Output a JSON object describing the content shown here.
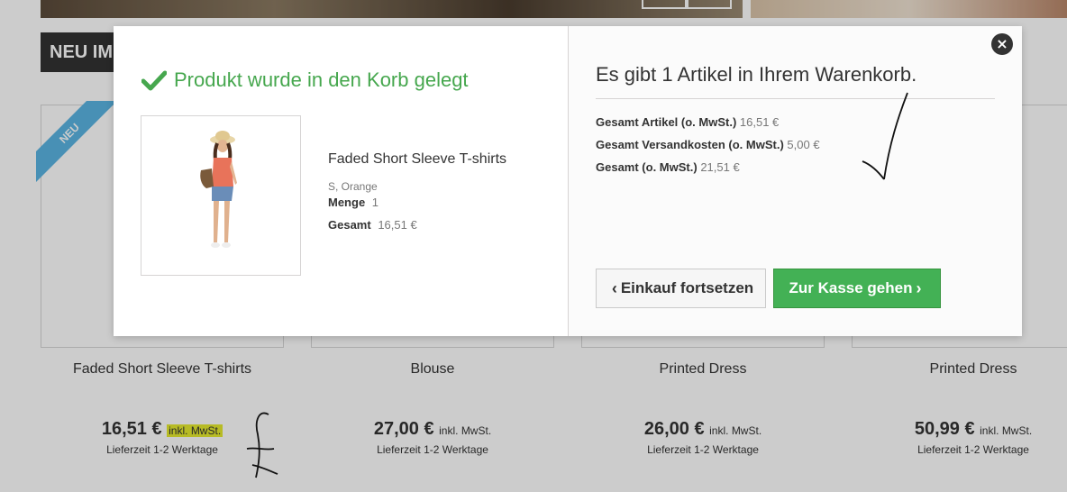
{
  "background": {
    "section_title": "NEU IM",
    "ribbon_label": "NEU",
    "products": [
      {
        "name": "Faded Short Sleeve T-shirts",
        "price": "16,51 €",
        "tax_note": "inkl. MwSt.",
        "delivery": "Lieferzeit 1-2 Werktage",
        "highlighted": true
      },
      {
        "name": "Blouse",
        "price": "27,00 €",
        "tax_note": "inkl. MwSt.",
        "delivery": "Lieferzeit 1-2 Werktage",
        "highlighted": false
      },
      {
        "name": "Printed Dress",
        "price": "26,00 €",
        "tax_note": "inkl. MwSt.",
        "delivery": "Lieferzeit 1-2 Werktage",
        "highlighted": false
      },
      {
        "name": "Printed Dress",
        "price": "50,99 €",
        "tax_note": "inkl. MwSt.",
        "delivery": "Lieferzeit 1-2 Werktage",
        "highlighted": false
      }
    ]
  },
  "modal": {
    "success_title": "Produkt wurde in den Korb gelegt",
    "product": {
      "name": "Faded Short Sleeve T-shirts",
      "attributes": "S, Orange",
      "quantity_label": "Menge",
      "quantity": "1",
      "total_label": "Gesamt",
      "total": "16,51 €"
    },
    "cart_title": "Es gibt 1 Artikel in Ihrem Warenkorb.",
    "summary": {
      "items_label": "Gesamt Artikel (o. MwSt.)",
      "items_value": "16,51 €",
      "shipping_label": "Gesamt Versandkosten (o. MwSt.)",
      "shipping_value": "5,00 €",
      "total_label": "Gesamt (o. MwSt.)",
      "total_value": "21,51 €"
    },
    "continue_label": "Einkauf fortsetzen",
    "checkout_label": "Zur Kasse gehen",
    "close_icon": "close-icon"
  },
  "colors": {
    "success": "#46a74e",
    "checkout_button": "#43b155",
    "ribbon": "#5bb5e3",
    "highlight": "#e5ea2f"
  }
}
